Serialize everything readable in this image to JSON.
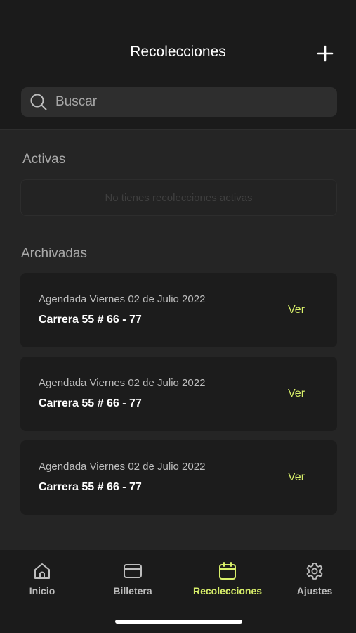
{
  "header": {
    "title": "Recolecciones",
    "add_icon": "plus-icon"
  },
  "search": {
    "placeholder": "Buscar",
    "icon": "search-icon"
  },
  "active_section": {
    "title": "Activas",
    "empty_message": "No tienes recolecciones activas"
  },
  "archived_section": {
    "title": "Archivadas",
    "items": [
      {
        "date": "Agendada Viernes 02 de Julio 2022",
        "address": "Carrera 55 # 66 - 77",
        "action": "Ver"
      },
      {
        "date": "Agendada Viernes 02 de Julio 2022",
        "address": "Carrera 55 # 66 - 77",
        "action": "Ver"
      },
      {
        "date": "Agendada Viernes 02 de Julio 2022",
        "address": "Carrera 55 # 66 - 77",
        "action": "Ver"
      }
    ]
  },
  "tabbar": {
    "tabs": [
      {
        "label": "Inicio",
        "icon": "home-icon",
        "active": false
      },
      {
        "label": "Billetera",
        "icon": "wallet-card-icon",
        "active": false
      },
      {
        "label": "Recolecciones",
        "icon": "calendar-icon",
        "active": true
      },
      {
        "label": "Ajustes",
        "icon": "gear-icon",
        "active": false
      }
    ]
  },
  "colors": {
    "accent": "#d8ef6a",
    "background": "#252525",
    "header_bg": "#1b1b1b",
    "card_bg": "#1c1c1c"
  }
}
